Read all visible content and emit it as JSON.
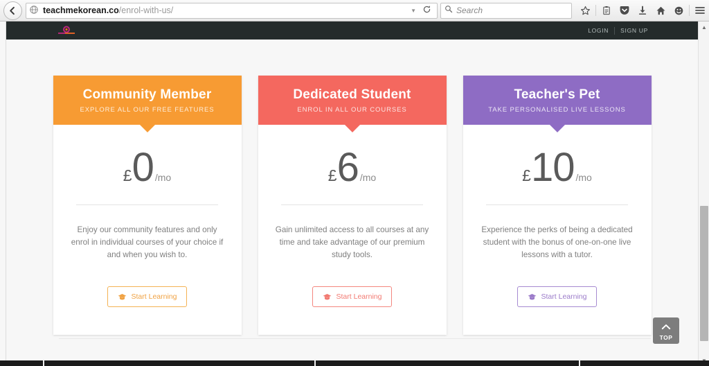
{
  "browser": {
    "back_icon": "back-arrow-icon",
    "identity_icon": "globe-icon",
    "url_host": "teachmekorean.co",
    "url_path": "/enrol-with-us/",
    "url_dropmarker": "▼",
    "reload_icon": "reload-icon",
    "search_icon": "search-icon",
    "search_placeholder": "Search",
    "toolbar_icons": [
      {
        "name": "bookmark-star-icon",
        "glyph": "☆"
      },
      {
        "name": "reader-view-icon",
        "glyph": "▤"
      },
      {
        "name": "pocket-icon",
        "glyph": "⛉"
      },
      {
        "name": "downloads-icon",
        "glyph": "⬇"
      },
      {
        "name": "home-icon",
        "glyph": "⌂"
      },
      {
        "name": "sync-account-icon",
        "glyph": "☻"
      },
      {
        "name": "menu-hamburger-icon",
        "glyph": "☰"
      }
    ]
  },
  "site": {
    "nav": {
      "logo_name": "teach-me-korean-logo",
      "login_label": "LOGIN",
      "signup_label": "SIGN UP",
      "divider": "|"
    },
    "pricing_cards": [
      {
        "id": "community-member",
        "title": "Community Member",
        "subtitle": "EXPLORE ALL OUR FREE FEATURES",
        "currency": "£",
        "amount": "0",
        "period": "/mo",
        "description": "Enjoy our community features and only enrol in individual courses of your choice if and when you wish to.",
        "cta_label": "Start Learning",
        "cta_icon": "graduation-cap-icon",
        "accent": "#f49b2e",
        "header_bg": "#f79b33"
      },
      {
        "id": "dedicated-student",
        "title": "Dedicated Student",
        "subtitle": "ENROL IN ALL OUR COURSES",
        "currency": "£",
        "amount": "6",
        "period": "/mo",
        "description": "Gain unlimited access to all courses at any time and take advantage of our premium study tools.",
        "cta_label": "Start Learning",
        "cta_icon": "graduation-cap-icon",
        "accent": "#f4685f",
        "header_bg": "#f4685f"
      },
      {
        "id": "teachers-pet",
        "title": "Teacher's Pet",
        "subtitle": "TAKE PERSONALISED LIVE LESSONS",
        "currency": "£",
        "amount": "10",
        "period": "/mo",
        "description": "Experience the perks of being a dedicated student with the bonus of one-on-one live lessons with a tutor.",
        "cta_label": "Start Learning",
        "cta_icon": "graduation-cap-icon",
        "accent": "#8e6cc4",
        "header_bg": "#8e6cc4"
      }
    ],
    "scroll_top": {
      "label": "TOP",
      "icon": "chevron-up-icon"
    }
  },
  "scrollbar": {
    "up_glyph": "▲",
    "down_glyph": "▼"
  }
}
